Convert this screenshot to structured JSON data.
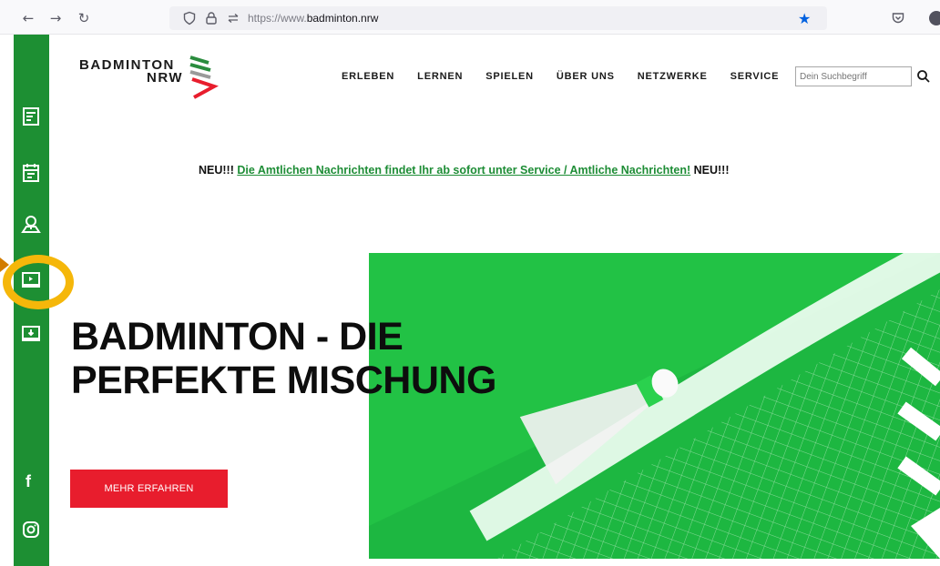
{
  "browser": {
    "url_prefix": "https://www.",
    "url_domain": "badminton.nrw",
    "back": "←",
    "forward": "→",
    "reload": "↻"
  },
  "logo": {
    "line1": "BADMINTON",
    "line2": "NRW"
  },
  "nav": {
    "items": [
      "ERLEBEN",
      "LERNEN",
      "SPIELEN",
      "ÜBER UNS",
      "NETZWERKE",
      "SERVICE"
    ]
  },
  "search": {
    "placeholder": "Dein Suchbegriff"
  },
  "notice": {
    "prefix": "NEU!!! ",
    "link": "Die Amtlichen Nachrichten findet Ihr ab sofort unter Service / Amtliche Nachrichten!",
    "suffix": " NEU!!!"
  },
  "hero": {
    "title_line1": "BADMINTON - DIE",
    "title_line2": "PERFEKTE MISCHUNG",
    "cta_label": "MEHR ERFAHREN"
  },
  "sidebar": {
    "facebook_label": "f"
  },
  "colors": {
    "brand_green": "#1d8f33",
    "hero_green": "#22c245",
    "cta_red": "#e81d2d",
    "highlight": "#f5b70a"
  }
}
